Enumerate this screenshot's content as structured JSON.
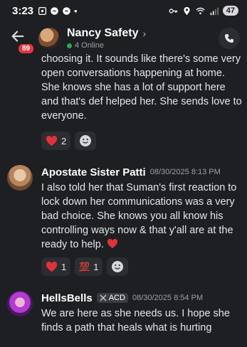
{
  "status_bar": {
    "time": "3:23",
    "dot": "•",
    "battery": "47"
  },
  "header": {
    "unread_count": "89",
    "channel_name": "Nancy Safety",
    "chevron": "›",
    "online_text": "4 Online"
  },
  "messages": [
    {
      "text": "choosing it. It sounds like there's some very open conversations happening at home. She knows she has a lot of support here and that's def helped her. She sends love to everyone.",
      "reactions": [
        {
          "emoji": "heart",
          "count": "2"
        }
      ]
    },
    {
      "author": "Apostate Sister Patti",
      "timestamp": "08/30/2025 8:13 PM",
      "text": "I also told her that Suman's first reaction to lock down her communications was a very bad choice. She knows you all know his controlling ways now & that y'all are at the ready to help.",
      "reactions": [
        {
          "emoji": "heart",
          "count": "1"
        },
        {
          "emoji": "hundred",
          "count": "1",
          "glyph": "💯"
        }
      ]
    },
    {
      "author": "HellsBells",
      "role_tag": "ACD",
      "timestamp": "08/30/2025 8:54 PM",
      "text": "We are here as she needs us. I hope she finds a path that heals what is hurting"
    }
  ],
  "colors": {
    "background": "#1e1f23",
    "pill": "#2b2d31",
    "badge": "#e5353e",
    "heart": "#e1313b",
    "online": "#2fa55b"
  }
}
